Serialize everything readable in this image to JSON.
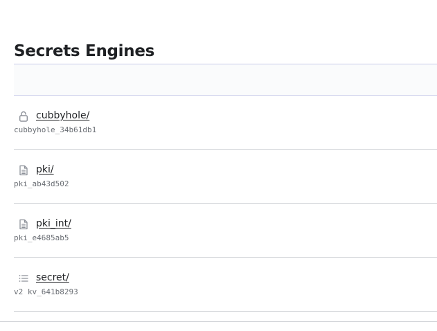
{
  "page": {
    "title": "Secrets Engines"
  },
  "engines": [
    {
      "path": "cubbyhole/",
      "accessor": "cubbyhole_34b61db1",
      "icon": "lock-open-icon"
    },
    {
      "path": "pki/",
      "accessor": "pki_ab43d502",
      "icon": "file-icon"
    },
    {
      "path": "pki_int/",
      "accessor": "pki_e4685ab5",
      "icon": "file-icon"
    },
    {
      "path": "secret/",
      "accessor": "v2 kv_641b8293",
      "icon": "list-icon"
    }
  ],
  "colors": {
    "text": "#1f2124",
    "muted": "#6a6e74",
    "icon": "#8d9199",
    "toolbar_border": "#c7c9e8",
    "divider": "#cfd1d6"
  }
}
